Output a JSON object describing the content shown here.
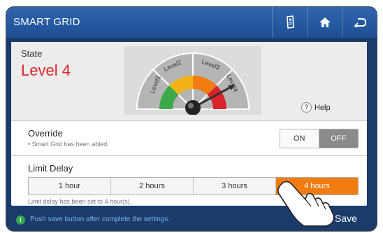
{
  "header": {
    "title": "SMART GRID",
    "icons": [
      "remote-icon",
      "home-icon",
      "back-icon"
    ]
  },
  "state": {
    "label": "State",
    "value": "Level 4",
    "gauge_levels": [
      "Level1",
      "Level2",
      "Level3",
      "Level4"
    ],
    "current_level": 4,
    "help_label": "Help"
  },
  "override": {
    "title": "Override",
    "subtitle": "• Smart Grid has been abled.",
    "on_label": "ON",
    "off_label": "OFF",
    "selected": "OFF"
  },
  "limit_delay": {
    "title": "Limit Delay",
    "options": [
      "1 hour",
      "2 hours",
      "3 hours",
      "4 hours"
    ],
    "selected_index": 3,
    "status": "Limit delay has been set to 4 hour(s)."
  },
  "footer": {
    "notice": "Push save button after complete the settings.",
    "save_label": "Save"
  },
  "colors": {
    "accent": "#f07c12",
    "state_value": "#d8242a",
    "titlebar": "#2a5ea6"
  }
}
